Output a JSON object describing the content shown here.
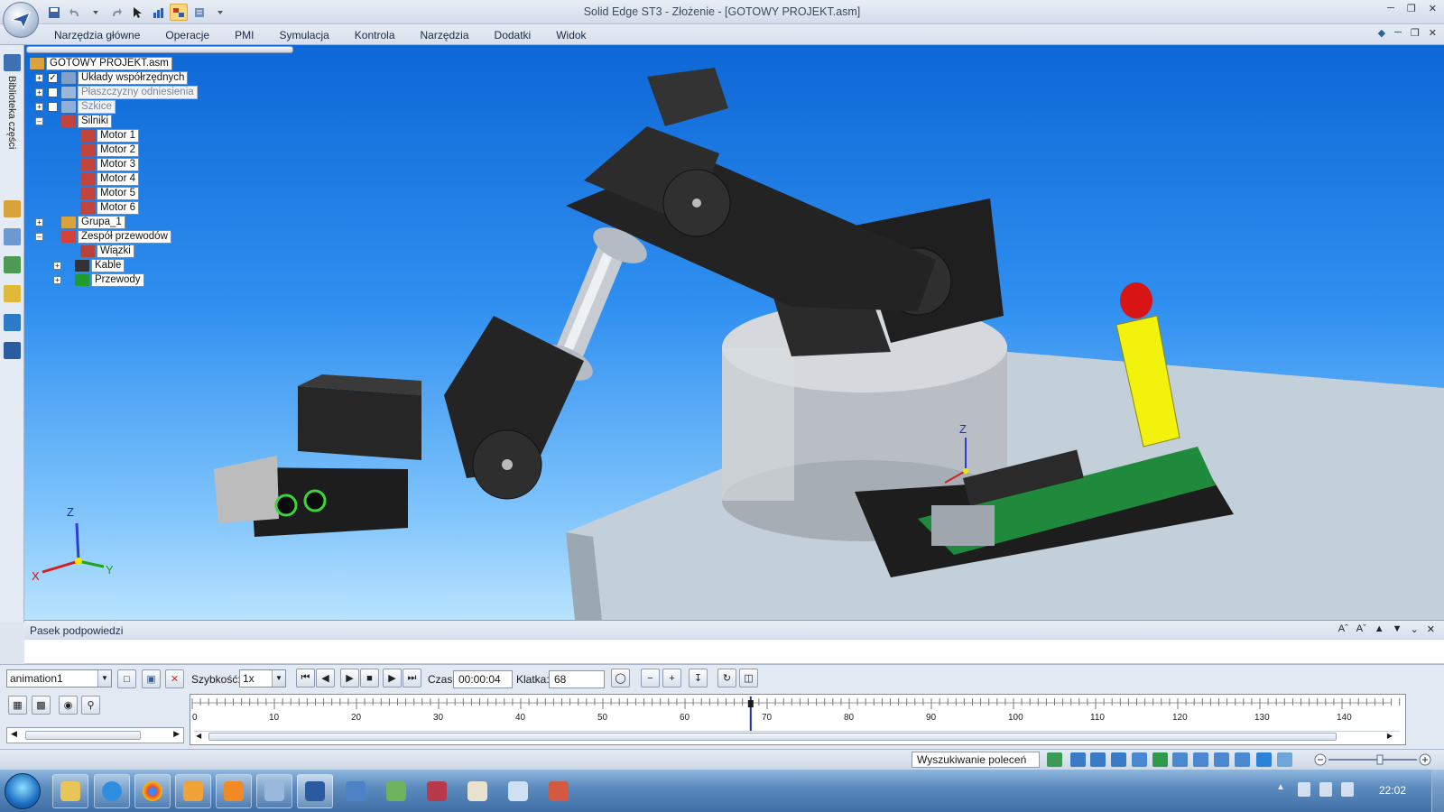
{
  "window": {
    "title": "Solid Edge ST3 - Złożenie - [GOTOWY PROJEKT.asm]"
  },
  "ribbon": {
    "tabs": [
      "Narzędzia główne",
      "Operacje",
      "PMI",
      "Symulacja",
      "Kontrola",
      "Narzędzia",
      "Dodatki",
      "Widok"
    ]
  },
  "left_rail": {
    "tab_label": "Biblioteka części"
  },
  "pathfinder": {
    "root": "GOTOWY PROJEKT.asm",
    "items": [
      {
        "label": "Układy współrzędnych",
        "checked": true,
        "expandable": true,
        "dim": false,
        "level": 0
      },
      {
        "label": "Płaszczyzny odniesienia",
        "checked": false,
        "expandable": true,
        "dim": true,
        "level": 0
      },
      {
        "label": "Szkice",
        "checked": false,
        "expandable": true,
        "dim": true,
        "level": 0
      },
      {
        "label": "Silniki",
        "expandable": true,
        "expanded": true,
        "level": 0
      },
      {
        "label": "Motor 1",
        "level": 1
      },
      {
        "label": "Motor 2",
        "level": 1
      },
      {
        "label": "Motor 3",
        "level": 1
      },
      {
        "label": "Motor 4",
        "level": 1
      },
      {
        "label": "Motor 5",
        "level": 1
      },
      {
        "label": "Motor 6",
        "level": 1
      },
      {
        "label": "Grupa_1",
        "expandable": true,
        "level": 0
      },
      {
        "label": "Zespół przewodów",
        "expandable": true,
        "expanded": true,
        "level": 0
      },
      {
        "label": "Wiązki",
        "level": 1
      },
      {
        "label": "Kable",
        "expandable": true,
        "level": 1
      },
      {
        "label": "Przewody",
        "expandable": true,
        "level": 1
      }
    ]
  },
  "viewport": {
    "triad": {
      "x": "X",
      "y": "Y",
      "z": "Z"
    },
    "model_triad": {
      "z": "Z"
    }
  },
  "hint_bar": {
    "title": "Pasek podpowiedzi",
    "text": ""
  },
  "animation": {
    "name": "animation1",
    "speed_label": "Szybkość:",
    "speed_value": "1x",
    "time_label": "Czas:",
    "time_value": "00:00:04",
    "frame_label": "Klatka:",
    "frame_value": "68",
    "timeline_ticks": [
      "0",
      "10",
      "20",
      "30",
      "40",
      "50",
      "60",
      "70",
      "80",
      "90",
      "100",
      "110",
      "120",
      "130",
      "140"
    ],
    "timeline_max": 147,
    "current_frame": 68
  },
  "statusbar": {
    "command_search": "Wyszukiwanie poleceń"
  },
  "taskbar": {
    "clock": "22:02"
  },
  "colors": {
    "viewport_top": "#0d67d6",
    "viewport_bottom": "#b9e3ff",
    "robot_dark": "#2a2a2a",
    "pcb_green": "#1f8a3c",
    "handle_yellow": "#f2f20c",
    "knob_red": "#d81414"
  }
}
